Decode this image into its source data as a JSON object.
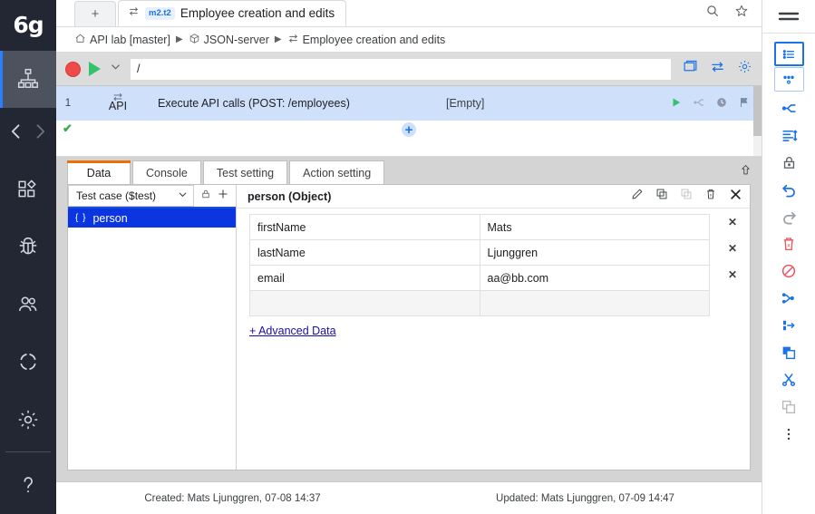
{
  "app": {
    "logo_text": "6g"
  },
  "left_rail": {
    "items": [
      {
        "name": "sitemap-icon",
        "label": "Project tree",
        "active": true
      },
      {
        "name": "nav-back-forward",
        "label": "Navigate"
      },
      {
        "name": "modules-icon",
        "label": "Modules"
      },
      {
        "name": "bug-icon",
        "label": "Defects"
      },
      {
        "name": "users-icon",
        "label": "Users"
      },
      {
        "name": "sync-icon",
        "label": "Sync"
      },
      {
        "name": "gear-icon",
        "label": "Settings"
      },
      {
        "name": "help-icon",
        "label": "Help"
      }
    ]
  },
  "tabstrip": {
    "new_tab_label": "+",
    "active_tab": {
      "badge": "m2.t2",
      "title": "Employee creation and edits",
      "icon": "transfer-icon"
    },
    "search_icon": "search-icon",
    "star_icon": "star-icon"
  },
  "breadcrumb": {
    "items": [
      {
        "icon": "home-icon",
        "label": "API lab [master]"
      },
      {
        "icon": "cube-icon",
        "label": "JSON-server"
      },
      {
        "icon": "transfer-icon",
        "label": "Employee creation and edits"
      }
    ],
    "separator": "▶"
  },
  "runbar": {
    "record_icon": "record-icon",
    "play_icon": "play-icon",
    "dropdown_icon": "chevron-down-icon",
    "url_value": "/",
    "url_placeholder": "/",
    "icons": [
      {
        "name": "window-icon"
      },
      {
        "name": "transfer-icon"
      },
      {
        "name": "gear-icon"
      }
    ]
  },
  "steps": {
    "rows": [
      {
        "number": "1",
        "status": "✔",
        "type_label": "API",
        "type_icon": "transfer-icon",
        "description": "Execute API calls (POST: /employees)",
        "value": "[Empty]",
        "actions": [
          {
            "name": "run-step-icon"
          },
          {
            "name": "branch-icon"
          },
          {
            "name": "timer-icon"
          },
          {
            "name": "flag-icon"
          }
        ]
      }
    ],
    "add_step_label": "+"
  },
  "panel": {
    "tabs": [
      {
        "label": "Data",
        "active": true
      },
      {
        "label": "Console",
        "active": false
      },
      {
        "label": "Test setting",
        "active": false
      },
      {
        "label": "Action setting",
        "active": false
      }
    ],
    "collapse_icon": "collapse-up-icon"
  },
  "variables": {
    "scope_select_value": "Test case ($test)",
    "lock_icon": "lock-icon",
    "add_icon": "plus-icon",
    "items": [
      {
        "braces": "{ }",
        "name": "person",
        "selected": true
      }
    ]
  },
  "object_editor": {
    "title": "person (Object)",
    "icons": [
      {
        "name": "edit-pencil-icon"
      },
      {
        "name": "copy-icon"
      },
      {
        "name": "paste-icon"
      },
      {
        "name": "delete-icon"
      },
      {
        "name": "close-icon"
      }
    ],
    "rows": [
      {
        "key": "firstName",
        "value": "Mats",
        "remove": "✕"
      },
      {
        "key": "lastName",
        "value": "Ljunggren",
        "remove": "✕"
      },
      {
        "key": "email",
        "value": "aa@bb.com",
        "remove": "✕"
      },
      {
        "key": "",
        "value": "",
        "remove": ""
      }
    ],
    "advanced_link": "+ Advanced Data"
  },
  "footer": {
    "created": "Created: Mats Ljunggren, 07-08 14:37",
    "updated": "Updated: Mats Ljunggren, 07-09 14:47"
  },
  "right_rail": {
    "menu_icon": "hamburger-icon",
    "items": [
      {
        "name": "list-view-icon",
        "style": "boxed-strong"
      },
      {
        "name": "graph-view-icon",
        "style": "boxed-light"
      },
      {
        "name": "split-branch-icon",
        "style": "plain"
      },
      {
        "name": "indent-lines-icon",
        "style": "plain"
      },
      {
        "name": "lock-icon",
        "style": "dark"
      },
      {
        "name": "undo-icon",
        "style": "plain"
      },
      {
        "name": "redo-icon",
        "style": "grey"
      },
      {
        "name": "delete-icon",
        "style": "red"
      },
      {
        "name": "disable-icon",
        "style": "red"
      },
      {
        "name": "merge-icon",
        "style": "plain"
      },
      {
        "name": "move-icon",
        "style": "plain"
      },
      {
        "name": "copy-icon",
        "style": "plain"
      },
      {
        "name": "cut-icon",
        "style": "plain"
      },
      {
        "name": "paste-icon",
        "style": "grey"
      },
      {
        "name": "more-options-icon",
        "style": "dark"
      }
    ]
  },
  "colors": {
    "accent_blue": "#1a73e8",
    "selection_blue": "#0b35e0",
    "step_row_blue": "#cfe0fb",
    "tab_orange": "#e8710a",
    "success_green": "#3aad4f",
    "record_red": "#f04a4a",
    "rail_dark": "#232733"
  }
}
